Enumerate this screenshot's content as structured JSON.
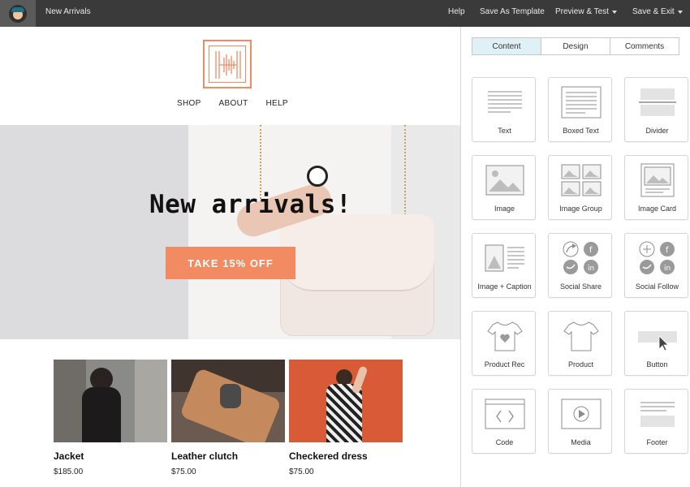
{
  "topbar": {
    "campaign_name": "New Arrivals",
    "help": "Help",
    "save_template": "Save As Template",
    "preview_test": "Preview & Test",
    "save_exit": "Save & Exit"
  },
  "email": {
    "nav": [
      "SHOP",
      "ABOUT",
      "HELP"
    ],
    "hero_title": "New arrivals!",
    "hero_cta": "TAKE 15% OFF",
    "products": [
      {
        "name": "Jacket",
        "price": "$185.00"
      },
      {
        "name": "Leather clutch",
        "price": "$75.00"
      },
      {
        "name": "Checkered dress",
        "price": "$75.00"
      }
    ],
    "accent_color": "#f28b62"
  },
  "panel": {
    "tabs": [
      "Content",
      "Design",
      "Comments"
    ],
    "active_tab": "Content",
    "blocks": [
      {
        "label": "Text",
        "icon": "text-block-icon"
      },
      {
        "label": "Boxed Text",
        "icon": "boxed-text-block-icon"
      },
      {
        "label": "Divider",
        "icon": "divider-block-icon"
      },
      {
        "label": "Image",
        "icon": "image-block-icon"
      },
      {
        "label": "Image Group",
        "icon": "image-group-block-icon"
      },
      {
        "label": "Image Card",
        "icon": "image-card-block-icon"
      },
      {
        "label": "Image + Caption",
        "icon": "image-caption-block-icon"
      },
      {
        "label": "Social Share",
        "icon": "social-share-block-icon"
      },
      {
        "label": "Social Follow",
        "icon": "social-follow-block-icon"
      },
      {
        "label": "Product Rec",
        "icon": "product-rec-block-icon"
      },
      {
        "label": "Product",
        "icon": "product-block-icon"
      },
      {
        "label": "Button",
        "icon": "button-block-icon"
      },
      {
        "label": "Code",
        "icon": "code-block-icon"
      },
      {
        "label": "Media",
        "icon": "media-block-icon"
      },
      {
        "label": "Footer",
        "icon": "footer-block-icon"
      }
    ]
  }
}
